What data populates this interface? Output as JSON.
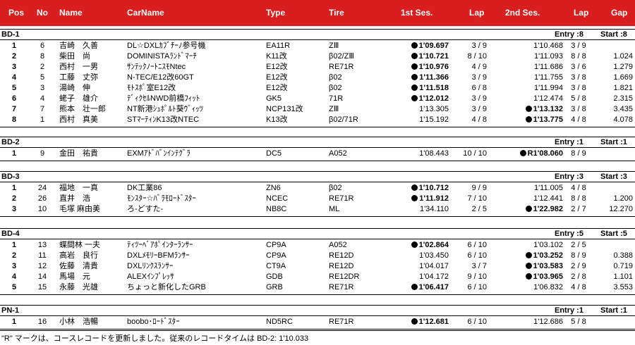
{
  "headers": {
    "pos": "Pos",
    "no": "No",
    "name": "Name",
    "carname": "CarName",
    "type": "Type",
    "tire": "Tire",
    "ses1": "1st Ses.",
    "lap1": "Lap",
    "ses2": "2nd Ses.",
    "lap2": "Lap",
    "gap": "Gap"
  },
  "groups": [
    {
      "name": "BD-1",
      "entry": "Entry :8",
      "start": "Start :8",
      "rows": [
        {
          "pos": "1",
          "no": "6",
          "name": "吉崎　久善",
          "car": "DL☆DXLｶﾌﾞﾁｰﾉ参号機",
          "type": "EA11R",
          "tire": "ZⅢ",
          "s1": "1'09.697",
          "s1b": true,
          "lap1": "3 / 9",
          "s2": "1'10.468",
          "s2b": false,
          "lap2": "3 / 9",
          "gap": ""
        },
        {
          "pos": "2",
          "no": "8",
          "name": "柴田　尚",
          "car": "DOMINISTAﾗﾝﾄﾞﾏｰﾁ",
          "type": "K11改",
          "tire": "β02/ZⅢ",
          "s1": "1'10.721",
          "s1b": true,
          "lap1": "8 / 10",
          "s2": "1'11.093",
          "s2b": false,
          "lap2": "8 / 8",
          "gap": "1.024"
        },
        {
          "pos": "3",
          "no": "2",
          "name": "西村　一男",
          "car": "ｻﾝﾃｯｸﾉｰﾄﾆｽﾓNtec",
          "type": "E12改",
          "tire": "RE71R",
          "s1": "1'10.976",
          "s1b": true,
          "lap1": "4 / 9",
          "s2": "1'11.686",
          "s2b": false,
          "lap2": "3 / 6",
          "gap": "1.279"
        },
        {
          "pos": "4",
          "no": "5",
          "name": "工藤　丈弥",
          "car": "N-TEC/E12改60GT",
          "type": "E12改",
          "tire": "β02",
          "s1": "1'11.366",
          "s1b": true,
          "lap1": "3 / 9",
          "s2": "1'11.755",
          "s2b": false,
          "lap2": "3 / 8",
          "gap": "1.669"
        },
        {
          "pos": "5",
          "no": "3",
          "name": "湯崎　伸",
          "car": "ﾓﾄｽﾎﾟ室E12改",
          "type": "E12改",
          "tire": "β02",
          "s1": "1'11.518",
          "s1b": true,
          "lap1": "6 / 8",
          "s2": "1'11.994",
          "s2b": false,
          "lap2": "3 / 8",
          "gap": "1.821"
        },
        {
          "pos": "6",
          "no": "4",
          "name": "蛯子　雄介",
          "car": "ﾃﾞｨｸｾﾙNWD前橋ﾌｨｯﾄ",
          "type": "GK5",
          "tire": "71R",
          "s1": "1'12.012",
          "s1b": true,
          "lap1": "3 / 9",
          "s2": "1'12.474",
          "s2b": false,
          "lap2": "5 / 8",
          "gap": "2.315"
        },
        {
          "pos": "7",
          "no": "7",
          "name": "熊本　壮一郎",
          "car": "NT新港ｼｭﾎﾟﾙﾄ葵ｳﾞｨｯﾂ",
          "type": "NCP131改",
          "tire": "ZⅢ",
          "s1": "1'13.305",
          "s1b": false,
          "lap1": "3 / 9",
          "s2": "1'13.132",
          "s2b": true,
          "lap2": "3 / 8",
          "gap": "3.435"
        },
        {
          "pos": "8",
          "no": "1",
          "name": "西村　真美",
          "car": "STﾏｰﾃｨﾝK13改NTEC",
          "type": "K13改",
          "tire": "β02/71R",
          "s1": "1'15.192",
          "s1b": false,
          "lap1": "4 / 8",
          "s2": "1'13.775",
          "s2b": true,
          "lap2": "4 / 8",
          "gap": "4.078"
        }
      ]
    },
    {
      "name": "BD-2",
      "entry": "Entry :1",
      "start": "Start :1",
      "rows": [
        {
          "pos": "1",
          "no": "9",
          "name": "金田　祐貴",
          "car": "EXMｱﾄﾞﾊﾞﾝｲﾝﾃｸﾞﾗ",
          "type": "DC5",
          "tire": "A052",
          "s1": "1'08.443",
          "s1b": false,
          "lap1": "10 / 10",
          "s2": "R1'08.060",
          "s2b": true,
          "lap2": "8 / 9",
          "gap": ""
        }
      ]
    },
    {
      "name": "BD-3",
      "entry": "Entry :3",
      "start": "Start :3",
      "rows": [
        {
          "pos": "1",
          "no": "24",
          "name": "福地　一真",
          "car": "DK工業86",
          "type": "ZN6",
          "tire": "β02",
          "s1": "1'10.712",
          "s1b": true,
          "lap1": "9 / 9",
          "s2": "1'11.005",
          "s2b": false,
          "lap2": "4 / 8",
          "gap": ""
        },
        {
          "pos": "2",
          "no": "26",
          "name": "直井　浩",
          "car": "ﾓﾝｽﾀｰ☆ﾊﾞﾗﾓﾛｰﾄﾞｽﾀｰ",
          "type": "NCEC",
          "tire": "RE71R",
          "s1": "1'11.912",
          "s1b": true,
          "lap1": "7 / 10",
          "s2": "1'12.441",
          "s2b": false,
          "lap2": "8 / 8",
          "gap": "1.200"
        },
        {
          "pos": "3",
          "no": "10",
          "name": "毛塚 麻由美",
          "car": "ろ-どすた-",
          "type": "NB8C",
          "tire": "ML",
          "s1": "1'34.110",
          "s1b": false,
          "lap1": "2 / 5",
          "s2": "1'22.982",
          "s2b": true,
          "lap2": "2 / 7",
          "gap": "12.270"
        }
      ]
    },
    {
      "name": "BD-4",
      "entry": "Entry :5",
      "start": "Start :5",
      "rows": [
        {
          "pos": "1",
          "no": "13",
          "name": "蝶間林 一夫",
          "car": "ﾃｨﾂｰﾍﾞｱﾎﾟｲﾝﾀｰﾗﾝｻｰ",
          "type": "CP9A",
          "tire": "A052",
          "s1": "1'02.864",
          "s1b": true,
          "lap1": "6 / 10",
          "s2": "1'03.102",
          "s2b": false,
          "lap2": "2 / 5",
          "gap": ""
        },
        {
          "pos": "2",
          "no": "11",
          "name": "高岩　良行",
          "car": "DXLﾒﾓﾘｰBFMﾗﾝｻｰ",
          "type": "CP9A",
          "tire": "RE12D",
          "s1": "1'03.450",
          "s1b": false,
          "lap1": "6 / 10",
          "s2": "1'03.252",
          "s2b": true,
          "lap2": "8 / 9",
          "gap": "0.388"
        },
        {
          "pos": "3",
          "no": "12",
          "name": "佐藤　清貴",
          "car": "DXLﾘﾝｸｽﾗﾝｻｰ",
          "type": "CT9A",
          "tire": "RE12D",
          "s1": "1'04.017",
          "s1b": false,
          "lap1": "3 / 7",
          "s2": "1'03.583",
          "s2b": true,
          "lap2": "2 / 9",
          "gap": "0.719"
        },
        {
          "pos": "4",
          "no": "14",
          "name": "馬場　元",
          "car": "ALEXｲﾝﾌﾟﾚｯｻ",
          "type": "GDB",
          "tire": "RE12DR",
          "s1": "1'04.172",
          "s1b": false,
          "lap1": "9 / 10",
          "s2": "1'03.965",
          "s2b": true,
          "lap2": "2 / 8",
          "gap": "1.101"
        },
        {
          "pos": "5",
          "no": "15",
          "name": "永藤　光雄",
          "car": "ちょっと新化したGRB",
          "type": "GRB",
          "tire": "RE71R",
          "s1": "1'06.417",
          "s1b": true,
          "lap1": "6 / 10",
          "s2": "1'06.832",
          "s2b": false,
          "lap2": "4 / 8",
          "gap": "3.553"
        }
      ]
    },
    {
      "name": "PN-1",
      "entry": "Entry :1",
      "start": "Start :1",
      "rows": [
        {
          "pos": "1",
          "no": "16",
          "name": "小林　浩暢",
          "car": "boobo･ﾛｰﾄﾞｽﾀｰ",
          "type": "ND5RC",
          "tire": "RE71R",
          "s1": "1'12.681",
          "s1b": true,
          "lap1": "6 / 10",
          "s2": "1'12.686",
          "s2b": false,
          "lap2": "5 / 8",
          "gap": ""
        }
      ]
    }
  ],
  "note": "\"R\" マークは、コースレコードを更新しました。従来のレコードタイムは BD-2: 1'10.033"
}
